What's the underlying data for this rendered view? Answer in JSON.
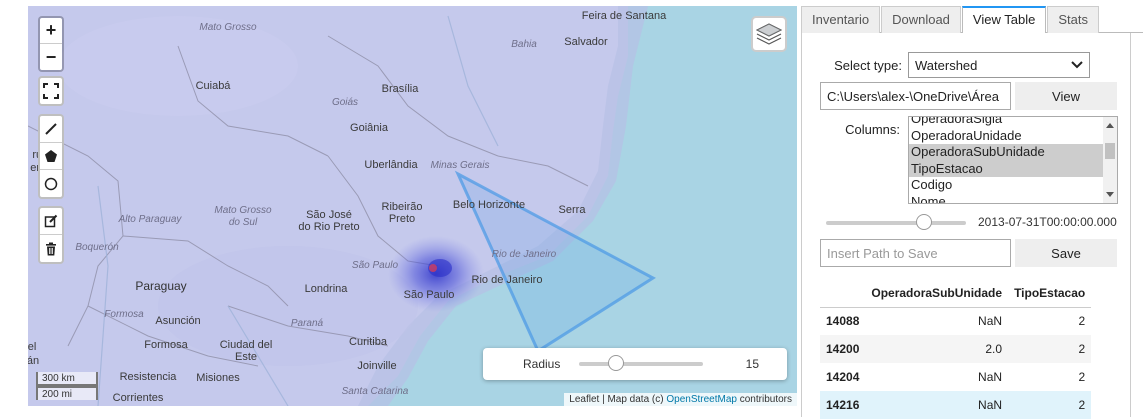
{
  "map": {
    "zoom_in": "+",
    "zoom_out": "−",
    "labels": {
      "feira_de_santana": "Feira de Santana",
      "salvador": "Salvador",
      "bahia": "Bahia",
      "mato_grosso": "Mato Grosso",
      "cuiaba": "Cuiabá",
      "brasilia": "Brasília",
      "goias": "Goiás",
      "goiania": "Goiânia",
      "uberlandia": "Uberlândia",
      "minas_gerais": "Minas Gerais",
      "ruz": "ruz",
      "erra": "erra",
      "mato_grosso_do_sul": "Mato Grosso\ndo Sul",
      "alto_paraguay": "Alto Paraguay",
      "sao_jose": "São José\ndo Rio Preto",
      "ribeirao": "Ribeirão\nPreto",
      "belo_horizonte": "Belo Horizonte",
      "serra": "Serra",
      "boqueron": "Boquerón",
      "rio_de_janeiro_state": "Rio de Janeiro",
      "sao_paulo_state": "São Paulo",
      "rio_de_janeiro": "Rio de Janeiro",
      "paraguay": "Paraguay",
      "londrina": "Londrina",
      "sao_paulo": "São Paulo",
      "formosa_it": "Formosa",
      "asuncion": "Asunción",
      "parana": "Paraná",
      "formosa": "Formosa",
      "ciudad_del_este": "Ciudad del\nEste",
      "curitiba": "Curitiba",
      "el": "el",
      "an": "án",
      "resistencia": "Resistencia",
      "corrientes": "Corrientes",
      "misiones": "Misiones",
      "joinville": "Joinville",
      "santa_catarina": "Santa Catarina"
    },
    "scale_km": "300 km",
    "scale_mi": "200 mi",
    "attribution_prefix": "Leaflet | Map data (c) ",
    "attribution_link": "OpenStreetMap",
    "attribution_suffix": " contributors",
    "radius_label": "Radius",
    "radius_value": "15",
    "radius_fraction": 0.3
  },
  "panel": {
    "tabs": [
      "Inventario",
      "Download",
      "View Table",
      "Stats"
    ],
    "active_tab": "View Table",
    "select_type_label": "Select type:",
    "select_type_value": "Watershed",
    "path_value": "C:\\Users\\alex-\\OneDrive\\Área",
    "view_button": "View",
    "columns_label": "Columns:",
    "columns": [
      {
        "name": "OperadoraSigla",
        "selected": false
      },
      {
        "name": "OperadoraUnidade",
        "selected": false
      },
      {
        "name": "OperadoraSubUnidade",
        "selected": true
      },
      {
        "name": "TipoEstacao",
        "selected": true
      },
      {
        "name": "Codigo",
        "selected": false
      },
      {
        "name": "Nome",
        "selected": false
      }
    ],
    "date_value": "2013-07-31T00:00:00.000",
    "save_placeholder": "Insert Path to Save",
    "save_button": "Save",
    "table": {
      "headers": [
        "",
        "OperadoraSubUnidade",
        "TipoEstacao"
      ],
      "rows": [
        [
          "14088",
          "NaN",
          "2"
        ],
        [
          "14200",
          "2.0",
          "2"
        ],
        [
          "14204",
          "NaN",
          "2"
        ],
        [
          "14216",
          "NaN",
          "2"
        ]
      ]
    }
  },
  "colors": {
    "tab_accent": "#2196f3",
    "heatmap": "#7b80e8",
    "ocean": "#a9d4e4",
    "polygon": "#4f9be6"
  }
}
